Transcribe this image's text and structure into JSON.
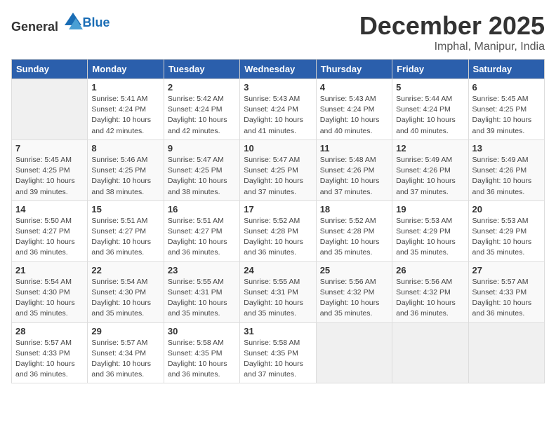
{
  "header": {
    "logo_general": "General",
    "logo_blue": "Blue",
    "month": "December 2025",
    "location": "Imphal, Manipur, India"
  },
  "weekdays": [
    "Sunday",
    "Monday",
    "Tuesday",
    "Wednesday",
    "Thursday",
    "Friday",
    "Saturday"
  ],
  "weeks": [
    [
      {
        "day": "",
        "info": ""
      },
      {
        "day": "1",
        "info": "Sunrise: 5:41 AM\nSunset: 4:24 PM\nDaylight: 10 hours\nand 42 minutes."
      },
      {
        "day": "2",
        "info": "Sunrise: 5:42 AM\nSunset: 4:24 PM\nDaylight: 10 hours\nand 42 minutes."
      },
      {
        "day": "3",
        "info": "Sunrise: 5:43 AM\nSunset: 4:24 PM\nDaylight: 10 hours\nand 41 minutes."
      },
      {
        "day": "4",
        "info": "Sunrise: 5:43 AM\nSunset: 4:24 PM\nDaylight: 10 hours\nand 40 minutes."
      },
      {
        "day": "5",
        "info": "Sunrise: 5:44 AM\nSunset: 4:24 PM\nDaylight: 10 hours\nand 40 minutes."
      },
      {
        "day": "6",
        "info": "Sunrise: 5:45 AM\nSunset: 4:25 PM\nDaylight: 10 hours\nand 39 minutes."
      }
    ],
    [
      {
        "day": "7",
        "info": "Sunrise: 5:45 AM\nSunset: 4:25 PM\nDaylight: 10 hours\nand 39 minutes."
      },
      {
        "day": "8",
        "info": "Sunrise: 5:46 AM\nSunset: 4:25 PM\nDaylight: 10 hours\nand 38 minutes."
      },
      {
        "day": "9",
        "info": "Sunrise: 5:47 AM\nSunset: 4:25 PM\nDaylight: 10 hours\nand 38 minutes."
      },
      {
        "day": "10",
        "info": "Sunrise: 5:47 AM\nSunset: 4:25 PM\nDaylight: 10 hours\nand 37 minutes."
      },
      {
        "day": "11",
        "info": "Sunrise: 5:48 AM\nSunset: 4:26 PM\nDaylight: 10 hours\nand 37 minutes."
      },
      {
        "day": "12",
        "info": "Sunrise: 5:49 AM\nSunset: 4:26 PM\nDaylight: 10 hours\nand 37 minutes."
      },
      {
        "day": "13",
        "info": "Sunrise: 5:49 AM\nSunset: 4:26 PM\nDaylight: 10 hours\nand 36 minutes."
      }
    ],
    [
      {
        "day": "14",
        "info": "Sunrise: 5:50 AM\nSunset: 4:27 PM\nDaylight: 10 hours\nand 36 minutes."
      },
      {
        "day": "15",
        "info": "Sunrise: 5:51 AM\nSunset: 4:27 PM\nDaylight: 10 hours\nand 36 minutes."
      },
      {
        "day": "16",
        "info": "Sunrise: 5:51 AM\nSunset: 4:27 PM\nDaylight: 10 hours\nand 36 minutes."
      },
      {
        "day": "17",
        "info": "Sunrise: 5:52 AM\nSunset: 4:28 PM\nDaylight: 10 hours\nand 36 minutes."
      },
      {
        "day": "18",
        "info": "Sunrise: 5:52 AM\nSunset: 4:28 PM\nDaylight: 10 hours\nand 35 minutes."
      },
      {
        "day": "19",
        "info": "Sunrise: 5:53 AM\nSunset: 4:29 PM\nDaylight: 10 hours\nand 35 minutes."
      },
      {
        "day": "20",
        "info": "Sunrise: 5:53 AM\nSunset: 4:29 PM\nDaylight: 10 hours\nand 35 minutes."
      }
    ],
    [
      {
        "day": "21",
        "info": "Sunrise: 5:54 AM\nSunset: 4:30 PM\nDaylight: 10 hours\nand 35 minutes."
      },
      {
        "day": "22",
        "info": "Sunrise: 5:54 AM\nSunset: 4:30 PM\nDaylight: 10 hours\nand 35 minutes."
      },
      {
        "day": "23",
        "info": "Sunrise: 5:55 AM\nSunset: 4:31 PM\nDaylight: 10 hours\nand 35 minutes."
      },
      {
        "day": "24",
        "info": "Sunrise: 5:55 AM\nSunset: 4:31 PM\nDaylight: 10 hours\nand 35 minutes."
      },
      {
        "day": "25",
        "info": "Sunrise: 5:56 AM\nSunset: 4:32 PM\nDaylight: 10 hours\nand 35 minutes."
      },
      {
        "day": "26",
        "info": "Sunrise: 5:56 AM\nSunset: 4:32 PM\nDaylight: 10 hours\nand 36 minutes."
      },
      {
        "day": "27",
        "info": "Sunrise: 5:57 AM\nSunset: 4:33 PM\nDaylight: 10 hours\nand 36 minutes."
      }
    ],
    [
      {
        "day": "28",
        "info": "Sunrise: 5:57 AM\nSunset: 4:33 PM\nDaylight: 10 hours\nand 36 minutes."
      },
      {
        "day": "29",
        "info": "Sunrise: 5:57 AM\nSunset: 4:34 PM\nDaylight: 10 hours\nand 36 minutes."
      },
      {
        "day": "30",
        "info": "Sunrise: 5:58 AM\nSunset: 4:35 PM\nDaylight: 10 hours\nand 36 minutes."
      },
      {
        "day": "31",
        "info": "Sunrise: 5:58 AM\nSunset: 4:35 PM\nDaylight: 10 hours\nand 37 minutes."
      },
      {
        "day": "",
        "info": ""
      },
      {
        "day": "",
        "info": ""
      },
      {
        "day": "",
        "info": ""
      }
    ]
  ]
}
